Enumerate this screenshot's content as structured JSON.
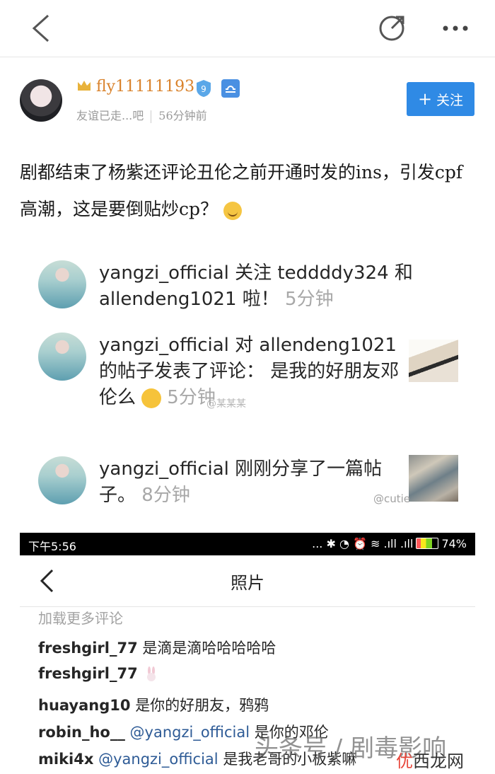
{
  "post": {
    "username": "fly11111193",
    "vip_level": "9",
    "bio": "友谊已走...吧",
    "time_ago": "56分钟前",
    "follow_label": "关注",
    "text": "剧都结束了杨紫还评论丑伦之前开通时发的ins，引发cpf高潮，这是要倒贴炒cp？"
  },
  "notifications": [
    {
      "user": "yangzi_official",
      "text": "关注 teddddy324 和 allendeng1021 啦！",
      "time": "5分钟"
    },
    {
      "user": "yangzi_official",
      "text": "对 allendeng1021 的帖子发表了评论： 是我的好朋友邓伦么",
      "time": "5分钟"
    },
    {
      "user": "yangzi_official",
      "text": "刚刚分享了一篇帖子。",
      "time": "8分钟"
    }
  ],
  "watermarks": {
    "wm1": "@某某某",
    "wm2": "@cutie"
  },
  "statusbar": {
    "time": "下午5:56",
    "icons": "... ✱ ◔ ⏰ ≋ .ıll .ıll",
    "battery": "74%"
  },
  "ig": {
    "title": "照片",
    "load_more": "加载更多评论",
    "comments": [
      {
        "user": "freshgirl_77",
        "mention": "",
        "text": "是滴是滴哈哈哈哈哈"
      },
      {
        "user": "freshgirl_77",
        "mention": "",
        "text": ""
      },
      {
        "user": "huayang10",
        "mention": "",
        "text": "是你的好朋友，鸦鸦"
      },
      {
        "user": "robin_ho__",
        "mention": "@yangzi_official",
        "text": "是你的邓伦"
      },
      {
        "user": "miki4x",
        "mention": "@yangzi_official",
        "text": "是我老哥的小板紫嘛"
      }
    ]
  },
  "site_watermark": {
    "toutiao": "头条号 / 剧毒影响",
    "brand_a": "优",
    "brand_b": "西龙网"
  },
  "colors": {
    "accent": "#2f8ae5",
    "username_orange": "#d9822b",
    "mention_blue": "#2e5b96"
  }
}
